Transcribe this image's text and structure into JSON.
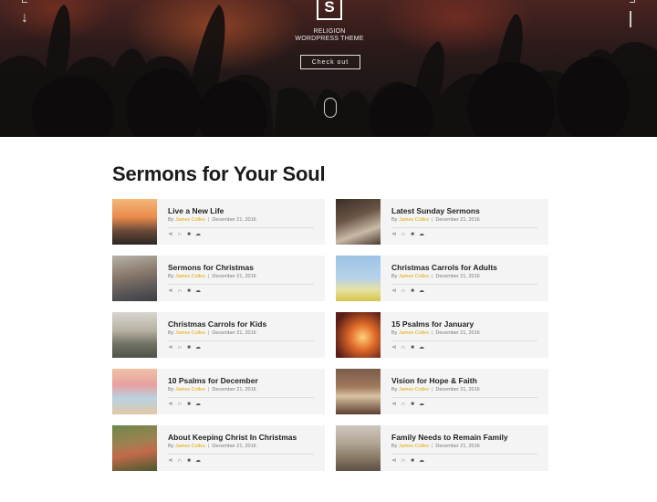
{
  "hero": {
    "logo_letter": "S",
    "subtitle_line1": "RELIGION",
    "subtitle_line2": "WORDPRESS THEME",
    "cta_label": "Check out"
  },
  "section": {
    "title": "Sermons for Your Soul"
  },
  "meta": {
    "by_label": "By",
    "author": "James Colles",
    "date": "December 21, 2016"
  },
  "colors": {
    "author_accent": "#e0a800",
    "card_bg": "#f4f4f4"
  },
  "icons": [
    "share-icon",
    "headphones-icon",
    "video-icon",
    "download-icon"
  ],
  "sermons": [
    {
      "title": "Live a New Life",
      "thumb": "sunset-person"
    },
    {
      "title": "Latest Sunday Sermons",
      "thumb": "open-book"
    },
    {
      "title": "Sermons for Christmas",
      "thumb": "praying-man"
    },
    {
      "title": "Christmas Carrols for Adults",
      "thumb": "church-field"
    },
    {
      "title": "Christmas Carrols for Kids",
      "thumb": "mountain-view"
    },
    {
      "title": "15 Psalms for January",
      "thumb": "candle-lights"
    },
    {
      "title": "10 Psalms for December",
      "thumb": "beach-people"
    },
    {
      "title": "Vision for Hope & Faith",
      "thumb": "church-interior"
    },
    {
      "title": "About Keeping Christ In Christmas",
      "thumb": "group-people"
    },
    {
      "title": "Family Needs to Remain Family",
      "thumb": "cathedral-hall"
    }
  ]
}
